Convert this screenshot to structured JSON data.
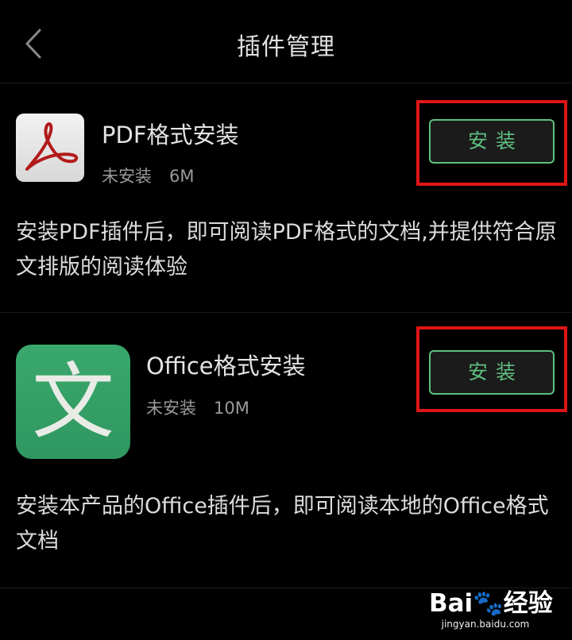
{
  "header": {
    "title": "插件管理",
    "back_icon": "chevron-left-icon"
  },
  "plugins": [
    {
      "icon": "pdf-acrobat-icon",
      "name": "PDF格式安装",
      "status": "未安装",
      "size": "6M",
      "button_label": "安装",
      "description": "安装PDF插件后，即可阅读PDF格式的文档,并提供符合原文排版的阅读体验"
    },
    {
      "icon": "office-wen-icon",
      "icon_glyph": "文",
      "name": "Office格式安装",
      "status": "未安装",
      "size": "10M",
      "button_label": "安装",
      "description": "安装本产品的Office插件后，即可阅读本地的Office格式文档"
    }
  ],
  "watermark": {
    "logo": "Bai🐾经验",
    "url": "jingyan.baidu.com"
  },
  "colors": {
    "background": "#000000",
    "accent_green": "#5fc07f",
    "highlight_red": "#e01515",
    "office_icon_green": "#34a065"
  }
}
